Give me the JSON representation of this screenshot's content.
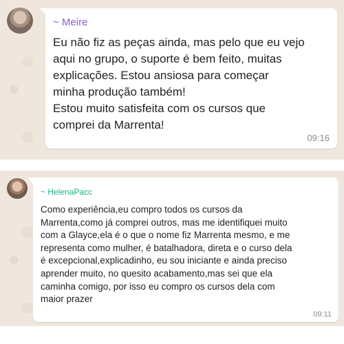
{
  "messages": [
    {
      "sender": "~ Meire",
      "text": "Eu não fiz as peças ainda, mas pelo que eu vejo\naqui no grupo, o suporte é bem feito, muitas\nexplicações. Estou ansiosa para começar\nminha produção também!\nEstou muito satisfeita com os cursos que\ncomprei da Marrenta!",
      "time": "09:16"
    },
    {
      "sender": "~ HelenaPacc",
      "text": "Como experiência,eu compro todos os cursos da\nMarrenta,como já comprei outros, mas me identifiquei muito\ncom a Glayce,ela é o que o nome fiz Marrenta mesmo, e me\nrepresenta como mulher, é batalhadora, direta e o curso dela\né excepcional,explicadinho, eu sou iniciante e ainda preciso\naprender muito, no quesito acabamento,mas sei que ela\ncaminha comigo, por isso eu compro os cursos dela com\nmaior prazer",
      "time": "09:11"
    }
  ],
  "colors": {
    "chat_background": "#efe7de",
    "bubble": "#ffffff",
    "sender_1": "#8a5cd6",
    "sender_2": "#14b08a",
    "timestamp": "#8c8c8c"
  }
}
